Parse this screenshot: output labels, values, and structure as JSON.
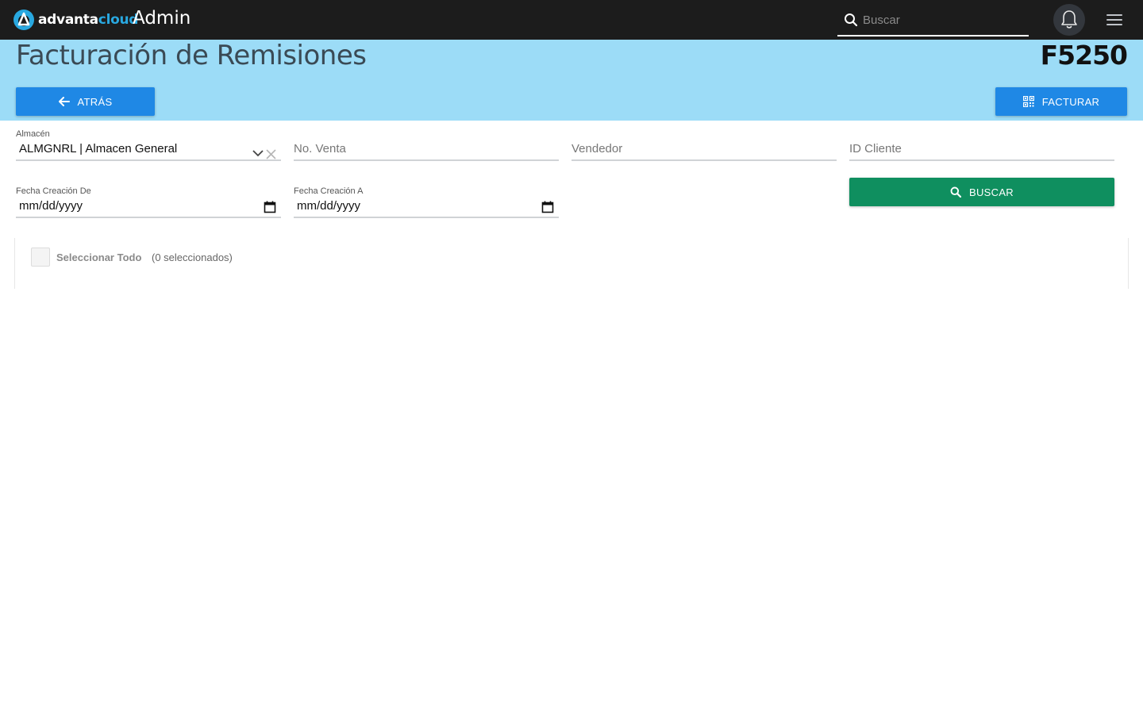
{
  "topbar": {
    "logo_text_main": "advanta",
    "logo_text_accent": "cloud",
    "app_title": "Admin",
    "search_placeholder": "Buscar",
    "icons": [
      "search-icon",
      "bell-icon",
      "hamburger-menu-icon"
    ]
  },
  "header": {
    "title": "Facturación de Remisiones",
    "code": "F5250",
    "back_label": "ATRÁS",
    "invoice_label": "FACTURAR"
  },
  "filters": {
    "almacen_label": "Almacén",
    "almacen_value": "ALMGNRL | Almacen General",
    "venta_placeholder": "No. Venta",
    "vendedor_placeholder": "Vendedor",
    "cliente_placeholder": "ID Cliente",
    "fecha_de_label": "Fecha Creación De",
    "fecha_de_value": "mm/dd/yyyy",
    "fecha_a_label": "Fecha Creación A",
    "fecha_a_value": "mm/dd/yyyy",
    "search_label": "BUSCAR"
  },
  "selection": {
    "select_all_label": "Seleccionar Todo",
    "selected_count": "(0 seleccionados)"
  },
  "colors": {
    "topbar": "#1c1c1c",
    "header_band": "#9cdcf7",
    "primary": "#1f88e5",
    "success": "#0f8f5f",
    "logo_accent": "#29a8e0"
  }
}
